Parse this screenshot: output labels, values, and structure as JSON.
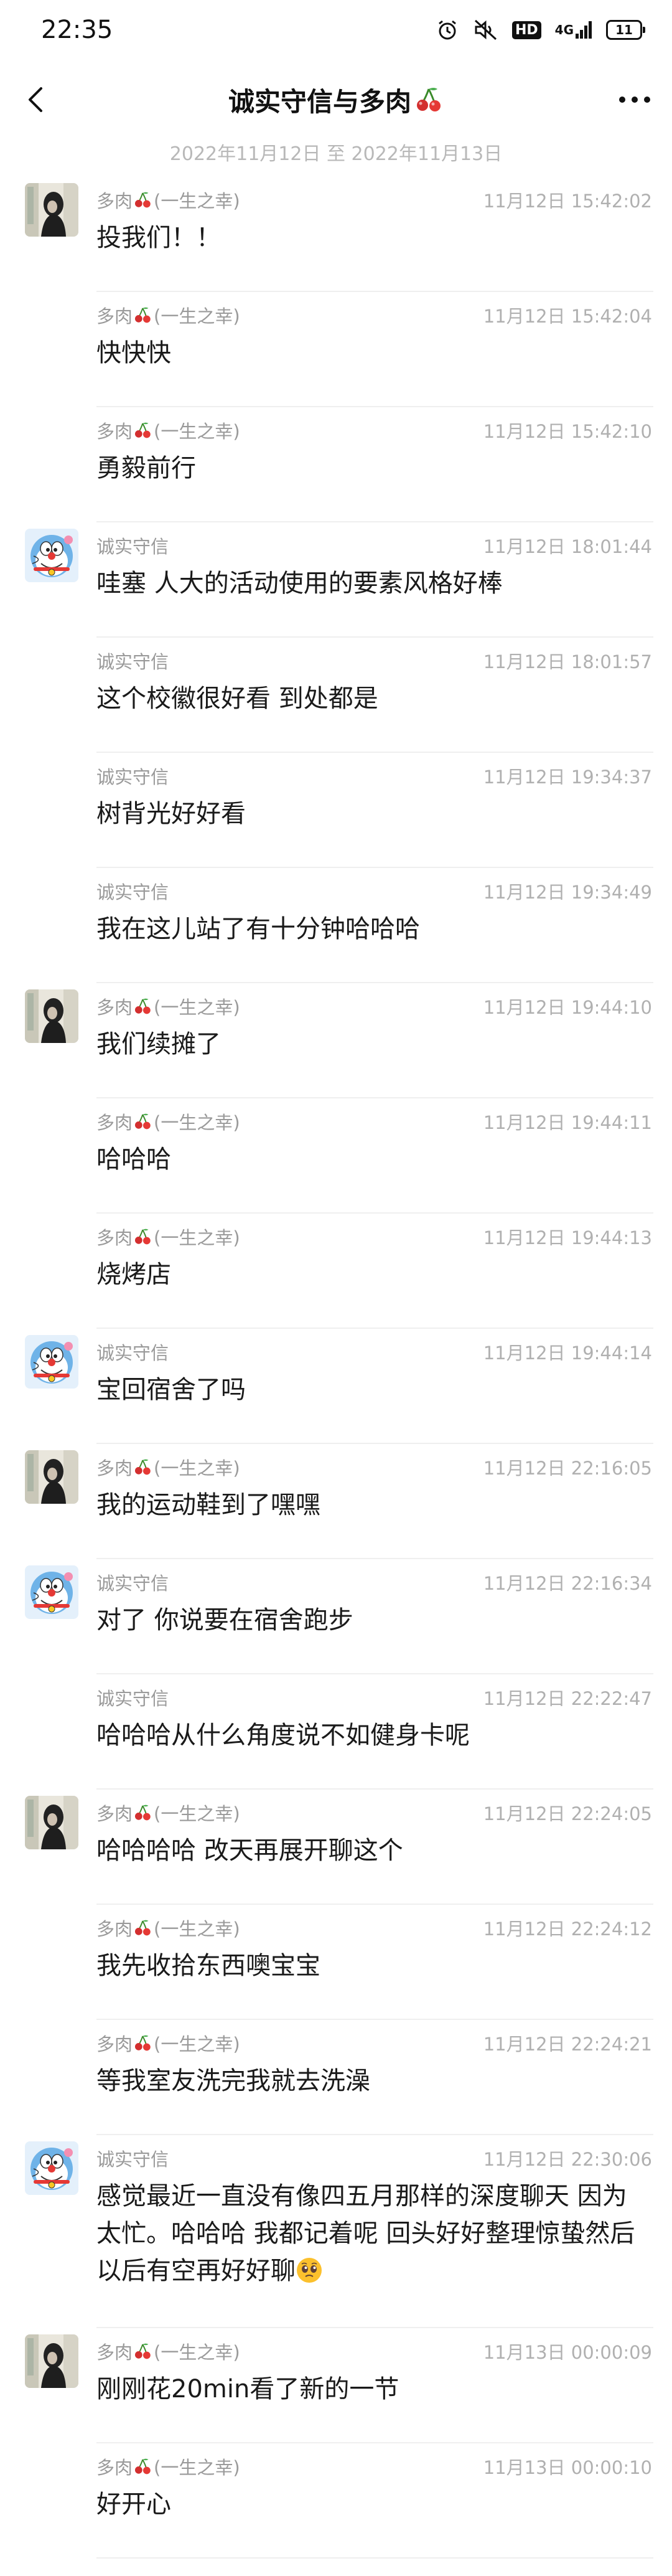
{
  "status_bar": {
    "time": "22:35",
    "network": "4G",
    "battery": "11",
    "hd": "HD",
    "icons": [
      "alarm-icon",
      "mute-icon",
      "hd-icon",
      "signal-icon",
      "battery-icon"
    ]
  },
  "header": {
    "title": "诚实守信与多肉",
    "title_emoji": "cherry-icon",
    "back_icon": "chevron-left-icon",
    "more_icon": "more-icon",
    "date_range": "2022年11月12日 至 2022年11月13日"
  },
  "messages": [
    {
      "sender": "多肉",
      "sender_suffix": "(一生之幸)",
      "time": "11月12日 15:42:02",
      "text": "投我们！！",
      "avatar": "duorou"
    },
    {
      "sender": "多肉",
      "sender_suffix": "(一生之幸)",
      "time": "11月12日 15:42:04",
      "text": "快快快",
      "avatar": ""
    },
    {
      "sender": "多肉",
      "sender_suffix": "(一生之幸)",
      "time": "11月12日 15:42:10",
      "text": "勇毅前行",
      "avatar": ""
    },
    {
      "sender": "诚实守信",
      "sender_suffix": "",
      "time": "11月12日 18:01:44",
      "text": "哇塞 人大的活动使用的要素风格好棒",
      "avatar": "chengshi"
    },
    {
      "sender": "诚实守信",
      "sender_suffix": "",
      "time": "11月12日 18:01:57",
      "text": "这个校徽很好看 到处都是",
      "avatar": ""
    },
    {
      "sender": "诚实守信",
      "sender_suffix": "",
      "time": "11月12日 19:34:37",
      "text": "树背光好好看",
      "avatar": ""
    },
    {
      "sender": "诚实守信",
      "sender_suffix": "",
      "time": "11月12日 19:34:49",
      "text": "我在这儿站了有十分钟哈哈哈",
      "avatar": ""
    },
    {
      "sender": "多肉",
      "sender_suffix": "(一生之幸)",
      "time": "11月12日 19:44:10",
      "text": "我们续摊了",
      "avatar": "duorou"
    },
    {
      "sender": "多肉",
      "sender_suffix": "(一生之幸)",
      "time": "11月12日 19:44:11",
      "text": "哈哈哈",
      "avatar": ""
    },
    {
      "sender": "多肉",
      "sender_suffix": "(一生之幸)",
      "time": "11月12日 19:44:13",
      "text": "烧烤店",
      "avatar": ""
    },
    {
      "sender": "诚实守信",
      "sender_suffix": "",
      "time": "11月12日 19:44:14",
      "text": "宝回宿舍了吗",
      "avatar": "chengshi"
    },
    {
      "sender": "多肉",
      "sender_suffix": "(一生之幸)",
      "time": "11月12日 22:16:05",
      "text": "我的运动鞋到了嘿嘿",
      "avatar": "duorou"
    },
    {
      "sender": "诚实守信",
      "sender_suffix": "",
      "time": "11月12日 22:16:34",
      "text": "对了 你说要在宿舍跑步",
      "avatar": "chengshi"
    },
    {
      "sender": "诚实守信",
      "sender_suffix": "",
      "time": "11月12日 22:22:47",
      "text": "哈哈哈从什么角度说不如健身卡呢",
      "avatar": ""
    },
    {
      "sender": "多肉",
      "sender_suffix": "(一生之幸)",
      "time": "11月12日 22:24:05",
      "text": "哈哈哈哈 改天再展开聊这个",
      "avatar": "duorou"
    },
    {
      "sender": "多肉",
      "sender_suffix": "(一生之幸)",
      "time": "11月12日 22:24:12",
      "text": "我先收拾东西噢宝宝",
      "avatar": ""
    },
    {
      "sender": "多肉",
      "sender_suffix": "(一生之幸)",
      "time": "11月12日 22:24:21",
      "text": "等我室友洗完我就去洗澡",
      "avatar": ""
    },
    {
      "sender": "诚实守信",
      "sender_suffix": "",
      "time": "11月12日 22:30:06",
      "text": "感觉最近一直没有像四五月那样的深度聊天 因为太忙。哈哈哈 我都记着呢 回头好好整理惊蛰然后以后有空再好好聊",
      "emoji": "pleading-face-icon",
      "avatar": "chengshi",
      "tall": true
    },
    {
      "sender": "多肉",
      "sender_suffix": "(一生之幸)",
      "time": "11月13日 00:00:09",
      "text": "刚刚花20min看了新的一节",
      "avatar": "duorou"
    },
    {
      "sender": "多肉",
      "sender_suffix": "(一生之幸)",
      "time": "11月13日 00:00:10",
      "text": "好开心",
      "avatar": ""
    }
  ]
}
